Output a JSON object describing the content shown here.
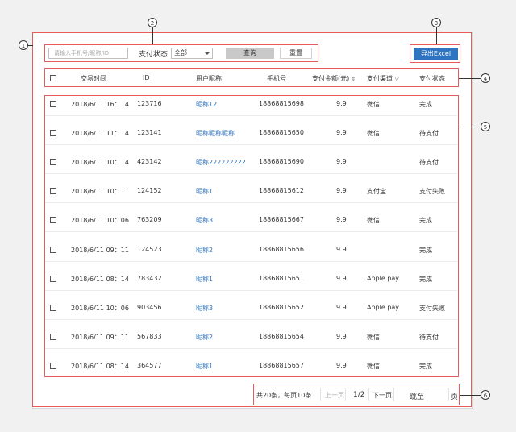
{
  "filters": {
    "search_placeholder": "请输入手机号/昵称/ID",
    "status_label": "支付状态",
    "status_value": "全部",
    "query_label": "查询",
    "reset_label": "重置",
    "export_label": "导出Excel"
  },
  "table": {
    "headers": [
      "交易时间",
      "ID",
      "用户昵称",
      "手机号",
      "支付金额(元)",
      "支付渠道",
      "支付状态"
    ],
    "rows": [
      {
        "time": "2018/6/11 16：14",
        "id": "123716",
        "nick": "昵称12",
        "phone": "18868815698",
        "amount": "9.9",
        "channel": "微信",
        "status": "完成"
      },
      {
        "time": "2018/6/11 11：14",
        "id": "123141",
        "nick": "昵称昵称昵称",
        "phone": "18868815650",
        "amount": "9.9",
        "channel": "微信",
        "status": "待支付"
      },
      {
        "time": "2018/6/11 10：14",
        "id": "423142",
        "nick": "昵称222222222",
        "phone": "18868815690",
        "amount": "9.9",
        "channel": "",
        "status": "待支付"
      },
      {
        "time": "2018/6/11 10：11",
        "id": "124152",
        "nick": "昵称1",
        "phone": "18868815612",
        "amount": "9.9",
        "channel": "支付宝",
        "status": "支付失败"
      },
      {
        "time": "2018/6/11 10：06",
        "id": "763209",
        "nick": "昵称3",
        "phone": "18868815667",
        "amount": "9.9",
        "channel": "微信",
        "status": "完成"
      },
      {
        "time": "2018/6/11 09：11",
        "id": "124523",
        "nick": "昵称2",
        "phone": "18868815656",
        "amount": "9.9",
        "channel": "",
        "status": "完成"
      },
      {
        "time": "2018/6/11 08：14",
        "id": "783432",
        "nick": "昵称1",
        "phone": "18868815651",
        "amount": "9.9",
        "channel": "Apple pay",
        "status": "完成"
      },
      {
        "time": "2018/6/11 10：06",
        "id": "903456",
        "nick": "昵称3",
        "phone": "18868815652",
        "amount": "9.9",
        "channel": "Apple pay",
        "status": "支付失败"
      },
      {
        "time": "2018/6/11 09：11",
        "id": "567833",
        "nick": "昵称2",
        "phone": "18868815654",
        "amount": "9.9",
        "channel": "微信",
        "status": "待支付"
      },
      {
        "time": "2018/6/11 08：14",
        "id": "364577",
        "nick": "昵称1",
        "phone": "18868815657",
        "amount": "9.9",
        "channel": "微信",
        "status": "完成"
      }
    ]
  },
  "pagination": {
    "summary": "共20条，每页10条",
    "prev_label": "上一页",
    "page_indicator": "1/2",
    "next_label": "下一页",
    "jump_label": "跳至",
    "page_suffix": "页"
  },
  "annotations": [
    "1",
    "2",
    "3",
    "4",
    "5",
    "6"
  ],
  "colors": {
    "accent": "#2f74c0",
    "annotation_border": "#e85b5b",
    "query_button": "#c9c9c9"
  }
}
